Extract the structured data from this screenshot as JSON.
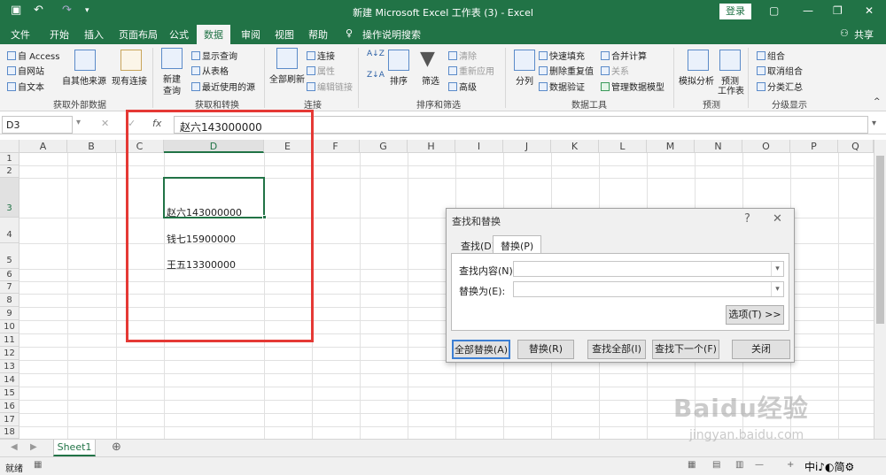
{
  "window": {
    "title": "新建 Microsoft Excel 工作表 (3)  -  Excel",
    "login": "登录",
    "share": "共享"
  },
  "tabs": [
    "文件",
    "开始",
    "插入",
    "页面布局",
    "公式",
    "数据",
    "审阅",
    "视图",
    "帮助"
  ],
  "tell_me": "操作说明搜索",
  "ribbon": {
    "ext_data": {
      "access": "自 Access",
      "web": "自网站",
      "text": "自文本",
      "other": "自其他来源",
      "existing": "现有连接",
      "group": "获取外部数据"
    },
    "transform": {
      "new_query": "新建",
      "new_query2": "查询",
      "show": "显示查询",
      "from_table": "从表格",
      "recent": "最近使用的源",
      "group": "获取和转换"
    },
    "connections": {
      "refresh_all": "全部刷新",
      "connections": "连接",
      "properties": "属性",
      "edit_links": "编辑链接",
      "group": "连接"
    },
    "sort_filter": {
      "sort": "排序",
      "filter": "筛选",
      "clear": "清除",
      "reapply": "重新应用",
      "advanced": "高级",
      "group": "排序和筛选"
    },
    "tools": {
      "split": "分列",
      "flash_fill": "快速填充",
      "remove_dup": "删除重复值",
      "validation": "数据验证",
      "consolidate": "合并计算",
      "relations": "关系",
      "data_model": "管理数据模型",
      "group": "数据工具"
    },
    "forecast": {
      "whatif": "模拟分析",
      "sheet1": "预测",
      "sheet2": "工作表",
      "group": "预测"
    },
    "outline": {
      "group_btn": "组合",
      "ungroup": "取消组合",
      "subtotal": "分类汇总",
      "group": "分级显示"
    }
  },
  "formula_bar": {
    "cell_ref": "D3",
    "content": "赵六143000000"
  },
  "columns": [
    "A",
    "B",
    "C",
    "D",
    "E",
    "F",
    "G",
    "H",
    "I",
    "J",
    "K",
    "L",
    "M",
    "N",
    "O",
    "P",
    "Q"
  ],
  "rows": [
    "1",
    "2",
    "3",
    "4",
    "5",
    "6",
    "7",
    "8",
    "9",
    "10",
    "11",
    "12",
    "13",
    "14",
    "15",
    "16",
    "17",
    "18"
  ],
  "cells": {
    "D3": "赵六143000000",
    "D4": "钱七15900000",
    "D5": "王五13300000"
  },
  "dialog": {
    "title": "查找和替换",
    "help": "?",
    "tab_find": "查找(D)",
    "tab_replace": "替换(P)",
    "find_label": "查找内容(N):",
    "replace_label": "替换为(E):",
    "options": "选项(T) >>",
    "replace_all": "全部替换(A)",
    "replace": "替换(R)",
    "find_all": "查找全部(I)",
    "find_next": "查找下一个(F)",
    "close": "关闭"
  },
  "sheet": {
    "name": "Sheet1"
  },
  "status": {
    "ready": "就绪"
  },
  "watermark": {
    "brand": "Baidu经验",
    "url": "jingyan.baidu.com"
  }
}
